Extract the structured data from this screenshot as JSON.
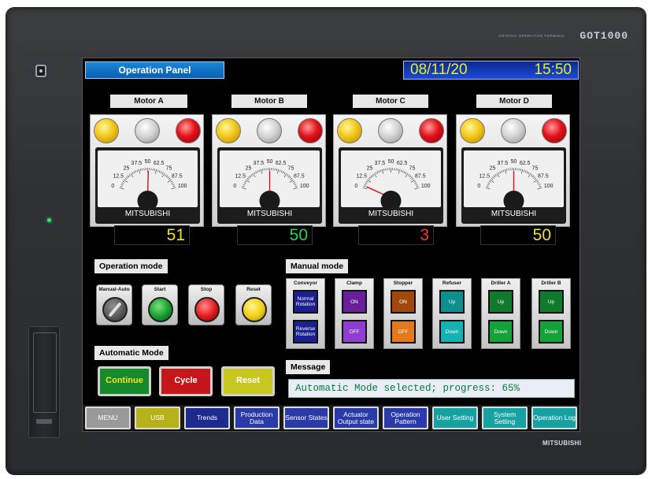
{
  "device": {
    "brand": "GOT1000",
    "brand_sub": "GRAPHIC OPERATION TERMINAL",
    "maker": "MITSUBISHI"
  },
  "header": {
    "title": "Operation Panel",
    "date": "08/11/20",
    "time": "15:50"
  },
  "motors": [
    {
      "name": "Motor A",
      "value": "51",
      "value_color": "#f2e12a",
      "gauge_value": 51,
      "gauge_brand": "MITSUBISHI"
    },
    {
      "name": "Motor B",
      "value": "50",
      "value_color": "#29d24a",
      "gauge_value": 50,
      "gauge_brand": "MITSUBISHI"
    },
    {
      "name": "Motor C",
      "value": "3",
      "value_color": "#ff3030",
      "gauge_value": 3,
      "gauge_brand": "MITSUBISHI"
    },
    {
      "name": "Motor D",
      "value": "50",
      "value_color": "#f2e12a",
      "gauge_value": 50,
      "gauge_brand": "MITSUBISHI"
    }
  ],
  "gauge_scale": [
    "0",
    "12.5",
    "25",
    "37.5",
    "50",
    "62.5",
    "75",
    "87.5",
    "100"
  ],
  "operation_mode": {
    "label": "Operation mode",
    "buttons": [
      {
        "label": "Manual-Auto",
        "icon": "key-switch-icon"
      },
      {
        "label": "Start",
        "icon": "green-pushbutton-icon"
      },
      {
        "label": "Stop",
        "icon": "red-pushbutton-icon"
      },
      {
        "label": "Reset",
        "icon": "yellow-pushbutton-icon"
      }
    ]
  },
  "manual_mode": {
    "label": "Manual mode",
    "groups": [
      {
        "label": "Conveyor",
        "top": "Normal Rotation",
        "bottom": "Reverse Rotation",
        "top_color": "#1b1f8f",
        "bottom_color": "#1b1f8f"
      },
      {
        "label": "Clamp",
        "top": "ON",
        "bottom": "OFF",
        "top_color": "#6a1f9a",
        "bottom_color": "#8e3fd0"
      },
      {
        "label": "Stopper",
        "top": "ON",
        "bottom": "OFF",
        "top_color": "#a2480c",
        "bottom_color": "#e2791d"
      },
      {
        "label": "Refuser",
        "top": "Up",
        "bottom": "Down",
        "top_color": "#0f8e90",
        "bottom_color": "#15b2b4"
      },
      {
        "label": "Driller A",
        "top": "Up",
        "bottom": "Down",
        "top_color": "#0f7a2c",
        "bottom_color": "#16a23a"
      },
      {
        "label": "Driller B",
        "top": "Up",
        "bottom": "Down",
        "top_color": "#0f7a2c",
        "bottom_color": "#16a23a"
      }
    ]
  },
  "automatic_mode": {
    "label": "Automatic Mode",
    "buttons": [
      {
        "label": "Continue",
        "text_color": "#f2e12a",
        "bg": "#168a2a"
      },
      {
        "label": "Cycle",
        "text_color": "#ffffff",
        "bg": "#c5161c"
      },
      {
        "label": "Reset",
        "text_color": "#ffffff",
        "bg": "#c8c620"
      }
    ]
  },
  "message": {
    "label": "Message",
    "text": "Automatic Mode selected; progress: 65%"
  },
  "menu": [
    {
      "label": "MENU",
      "bg": "#9a9a9a"
    },
    {
      "label": "USB",
      "bg": "#b7b21c"
    },
    {
      "label": "Trends",
      "bg": "#1d2a8f"
    },
    {
      "label": "Production Data",
      "bg": "#2a3aa8"
    },
    {
      "label": "Sensor States",
      "bg": "#2a3aa8"
    },
    {
      "label": "Actuator Output state",
      "bg": "#2a3aa8"
    },
    {
      "label": "Operation Pattern",
      "bg": "#2a3aa8"
    },
    {
      "label": "User Setting",
      "bg": "#16a1a3"
    },
    {
      "label": "System Setting",
      "bg": "#16a1a3"
    },
    {
      "label": "Operation Log",
      "bg": "#16a1a3"
    }
  ]
}
